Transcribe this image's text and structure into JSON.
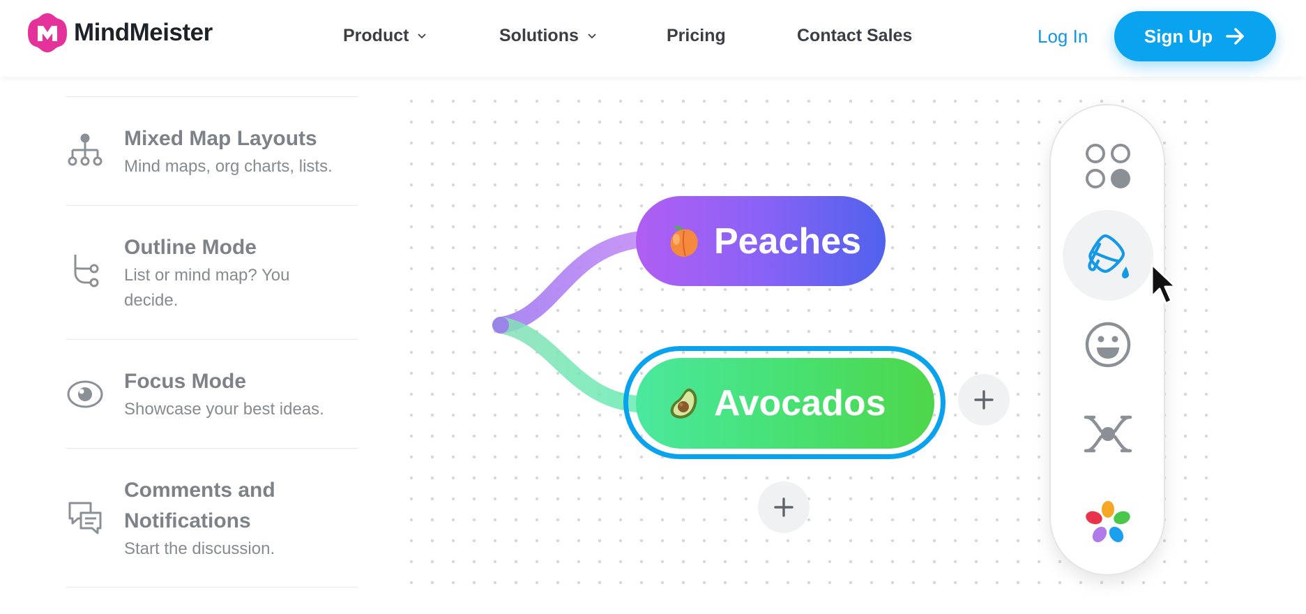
{
  "brand": {
    "name": "MindMeister"
  },
  "nav": {
    "product": "Product",
    "solutions": "Solutions",
    "pricing": "Pricing",
    "contact_sales": "Contact Sales",
    "login": "Log In",
    "signup": "Sign Up"
  },
  "features": [
    {
      "icon": "org-chart-icon",
      "title": "Mixed Map Layouts",
      "desc": "Mind maps, org charts, lists."
    },
    {
      "icon": "outline-branch-icon",
      "title": "Outline Mode",
      "desc_line1": "List or mind map? You",
      "desc_line2": "decide."
    },
    {
      "icon": "eye-icon",
      "title": "Focus Mode",
      "desc": "Showcase your best ideas."
    },
    {
      "icon": "comments-icon",
      "title_line1": "Comments and",
      "title_line2": "Notifications",
      "desc": "Start the discussion."
    }
  ],
  "mindmap": {
    "nodes": [
      {
        "emoji": "peach",
        "label": "Peaches",
        "gradient": [
          "#b15ef2",
          "#4f62ec"
        ]
      },
      {
        "emoji": "avocado",
        "label": "Avocados",
        "gradient": [
          "#4ae89e",
          "#4ed64a"
        ],
        "selected": true
      }
    ],
    "selection_color": "#08a2ee"
  },
  "toolbar": {
    "tools": [
      {
        "icon": "style-presets-icon"
      },
      {
        "icon": "paint-bucket-icon",
        "active": true
      },
      {
        "icon": "emoji-smiley-icon"
      },
      {
        "icon": "map-layout-icon"
      },
      {
        "icon": "color-palette-icon"
      }
    ]
  },
  "colors": {
    "accent": "#0aa3f0",
    "link": "#1296e6"
  }
}
